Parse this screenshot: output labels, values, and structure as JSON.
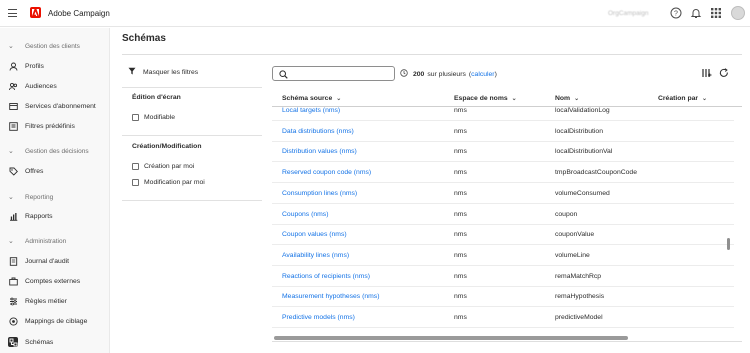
{
  "app": {
    "title": "Adobe Campaign",
    "org": "OrgCampaign"
  },
  "topbar_icons": [
    "help-icon",
    "bell-icon",
    "apps-grid-icon",
    "avatar"
  ],
  "sidebar": {
    "sections": [
      {
        "label": "Gestion des clients",
        "items": [
          "Profils",
          "Audiences",
          "Services d'abonnement",
          "Filtres prédéfinis"
        ]
      },
      {
        "label": "Gestion des décisions",
        "items": [
          "Offres"
        ]
      },
      {
        "label": "Reporting",
        "items": [
          "Rapports"
        ]
      },
      {
        "label": "Administration",
        "items": [
          "Journal d'audit",
          "Comptes externes",
          "Règles métier",
          "Mappings de ciblage",
          "Schémas"
        ]
      }
    ],
    "active": "Schémas"
  },
  "page": {
    "title": "Schémas"
  },
  "filters": {
    "toggle_label": "Masquer les filtres",
    "groups": [
      {
        "title": "Édition d'écran",
        "options": [
          "Modifiable"
        ]
      },
      {
        "title": "Création/Modification",
        "options": [
          "Création par moi",
          "Modification par moi"
        ]
      }
    ]
  },
  "search": {
    "placeholder": ""
  },
  "results": {
    "count": "200",
    "text": "sur plusieurs",
    "link": "calculer"
  },
  "table": {
    "columns": [
      "Schéma source",
      "Espace de noms",
      "Nom",
      "Création par"
    ],
    "rows": [
      [
        "Local targets (nms)",
        "nms",
        "localValidationLog"
      ],
      [
        "Data distributions (nms)",
        "nms",
        "localDistribution"
      ],
      [
        "Distribution values (nms)",
        "nms",
        "localDistributionVal"
      ],
      [
        "Reserved coupon code (nms)",
        "nms",
        "tmpBroadcastCouponCode"
      ],
      [
        "Consumption lines (nms)",
        "nms",
        "volumeConsumed"
      ],
      [
        "Coupons (nms)",
        "nms",
        "coupon"
      ],
      [
        "Coupon values (nms)",
        "nms",
        "couponValue"
      ],
      [
        "Availability lines (nms)",
        "nms",
        "volumeLine"
      ],
      [
        "Reactions of recipients (nms)",
        "nms",
        "remaMatchRcp"
      ],
      [
        "Measurement hypotheses (nms)",
        "nms",
        "remaHypothesis"
      ],
      [
        "Predictive models (nms)",
        "nms",
        "predictiveModel"
      ]
    ]
  },
  "colors": {
    "accent": "#1473e6",
    "brand": "#eb1000"
  }
}
